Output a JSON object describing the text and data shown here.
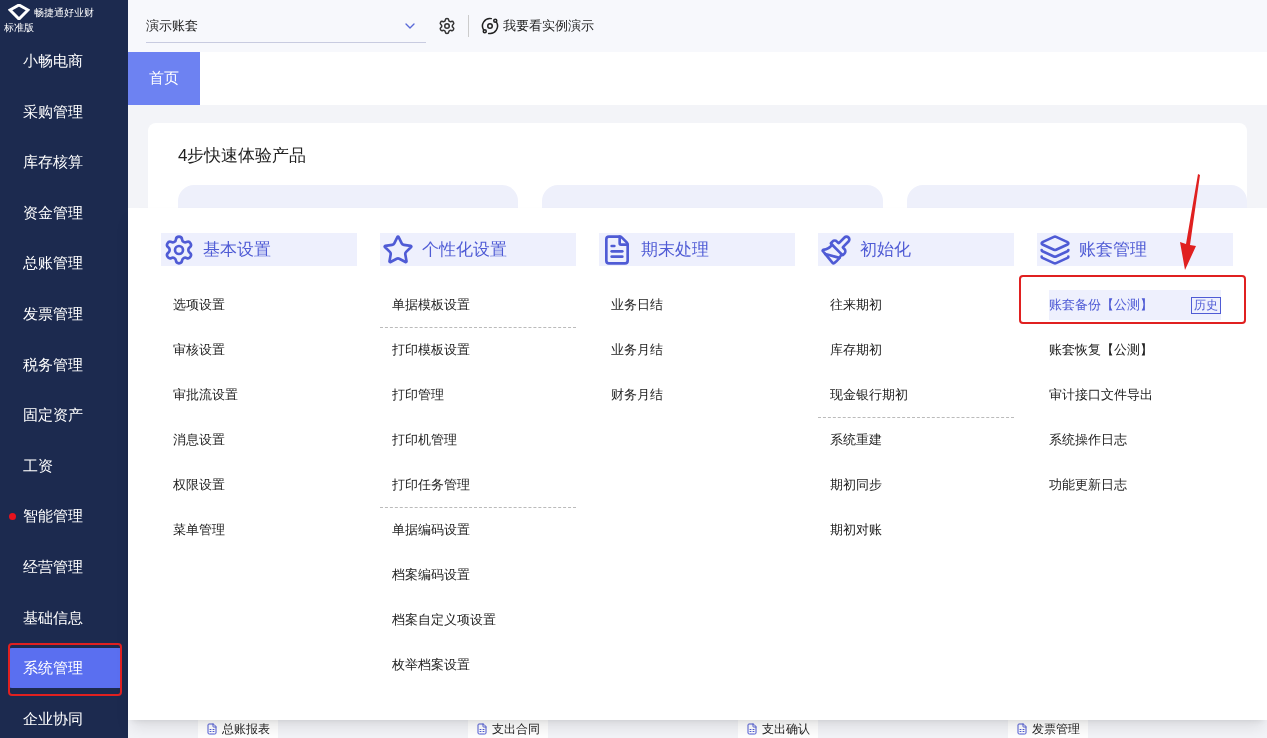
{
  "app": {
    "brand": "畅捷通好业财",
    "edition": "标准版"
  },
  "sidebar": {
    "items": [
      {
        "label": "小畅电商",
        "selected": false,
        "badge_dot": false
      },
      {
        "label": "采购管理",
        "selected": false,
        "badge_dot": false
      },
      {
        "label": "库存核算",
        "selected": false,
        "badge_dot": false
      },
      {
        "label": "资金管理",
        "selected": false,
        "badge_dot": false
      },
      {
        "label": "总账管理",
        "selected": false,
        "badge_dot": false
      },
      {
        "label": "发票管理",
        "selected": false,
        "badge_dot": false
      },
      {
        "label": "税务管理",
        "selected": false,
        "badge_dot": false
      },
      {
        "label": "固定资产",
        "selected": false,
        "badge_dot": false
      },
      {
        "label": "工资",
        "selected": false,
        "badge_dot": false
      },
      {
        "label": "智能管理",
        "selected": false,
        "badge_dot": true
      },
      {
        "label": "经营管理",
        "selected": false,
        "badge_dot": false
      },
      {
        "label": "基础信息",
        "selected": false,
        "badge_dot": false
      },
      {
        "label": "系统管理",
        "selected": true,
        "badge_dot": false
      },
      {
        "label": "企业协同",
        "selected": false,
        "badge_dot": false
      }
    ]
  },
  "topbar": {
    "account": "演示账套",
    "demo_link": "我要看实例演示"
  },
  "tabs": [
    {
      "label": "首页",
      "selected": true
    }
  ],
  "home": {
    "title": "4步快速体验产品"
  },
  "menu": {
    "columns": [
      {
        "kind": "gear",
        "title": "基本设置",
        "items": [
          {
            "label": "选项设置",
            "selected": false,
            "separator_after": false
          },
          {
            "label": "审核设置",
            "selected": false,
            "separator_after": false
          },
          {
            "label": "审批流设置",
            "selected": false,
            "separator_after": false
          },
          {
            "label": "消息设置",
            "selected": false,
            "separator_after": false
          },
          {
            "label": "权限设置",
            "selected": false,
            "separator_after": false
          },
          {
            "label": "菜单管理",
            "selected": false,
            "separator_after": false
          }
        ]
      },
      {
        "kind": "star",
        "title": "个性化设置",
        "items": [
          {
            "label": "单据模板设置",
            "selected": false,
            "separator_after": true
          },
          {
            "label": "打印模板设置",
            "selected": false,
            "separator_after": false
          },
          {
            "label": "打印管理",
            "selected": false,
            "separator_after": false
          },
          {
            "label": "打印机管理",
            "selected": false,
            "separator_after": false
          },
          {
            "label": "打印任务管理",
            "selected": false,
            "separator_after": true
          },
          {
            "label": "单据编码设置",
            "selected": false,
            "separator_after": false
          },
          {
            "label": "档案编码设置",
            "selected": false,
            "separator_after": false
          },
          {
            "label": "档案自定义项设置",
            "selected": false,
            "separator_after": false
          },
          {
            "label": "枚举档案设置",
            "selected": false,
            "separator_after": false
          }
        ]
      },
      {
        "kind": "document",
        "title": "期末处理",
        "items": [
          {
            "label": "业务日结",
            "selected": false,
            "separator_after": false
          },
          {
            "label": "业务月结",
            "selected": false,
            "separator_after": false
          },
          {
            "label": "财务月结",
            "selected": false,
            "separator_after": false
          }
        ]
      },
      {
        "kind": "brush",
        "title": "初始化",
        "items": [
          {
            "label": "往来期初",
            "selected": false,
            "separator_after": false
          },
          {
            "label": "库存期初",
            "selected": false,
            "separator_after": false
          },
          {
            "label": "现金银行期初",
            "selected": false,
            "separator_after": true
          },
          {
            "label": "系统重建",
            "selected": false,
            "separator_after": false
          },
          {
            "label": "期初同步",
            "selected": false,
            "separator_after": false
          },
          {
            "label": "期初对账",
            "selected": false,
            "separator_after": false
          }
        ]
      },
      {
        "kind": "stack",
        "title": "账套管理",
        "items": [
          {
            "label": "账套备份【公测】",
            "selected": true,
            "separator_after": false,
            "tag": "历史"
          },
          {
            "label": "账套恢复【公测】",
            "selected": false,
            "separator_after": false
          },
          {
            "label": "审计接口文件导出",
            "selected": false,
            "separator_after": false
          },
          {
            "label": "系统操作日志",
            "selected": false,
            "separator_after": false
          },
          {
            "label": "功能更新日志",
            "selected": false,
            "separator_after": false
          }
        ]
      }
    ]
  },
  "flow": [
    {
      "label": "总账报表"
    },
    {
      "label": "支出合同"
    },
    {
      "label": "支出确认"
    },
    {
      "label": "发票管理"
    }
  ]
}
